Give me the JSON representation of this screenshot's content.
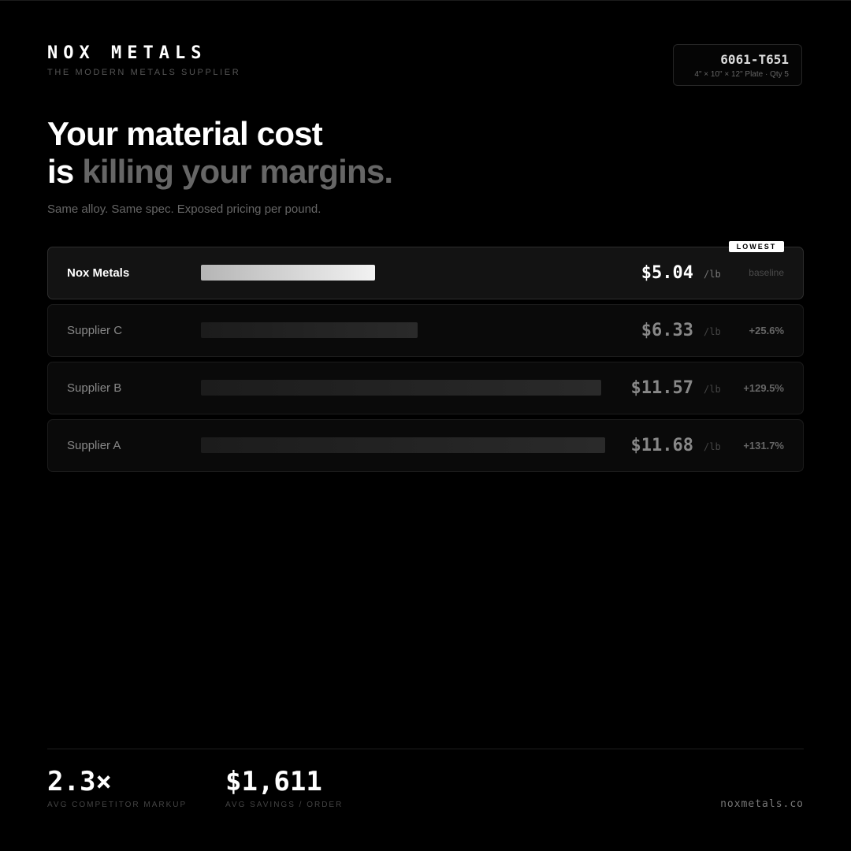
{
  "brand": {
    "name": "NOX METALS",
    "tagline": "THE MODERN METALS SUPPLIER"
  },
  "spec": {
    "alloy": "6061-T651",
    "detail": "4\" × 10\" × 12\" Plate · Qty 5"
  },
  "headline": {
    "line1": "Your material cost",
    "line2_lead": "is",
    "line2_rest": "killing your margins."
  },
  "subhead": "Same alloy. Same spec. Exposed pricing per pound.",
  "badge": "LOWEST",
  "suppliers": [
    {
      "name": "Nox Metals",
      "price": "$5.04",
      "unit": "/lb",
      "delta": "baseline",
      "bar_fraction": 0.41
    },
    {
      "name": "Supplier C",
      "price": "$6.33",
      "unit": "/lb",
      "delta": "+25.6%",
      "bar_fraction": 0.51
    },
    {
      "name": "Supplier B",
      "price": "$11.57",
      "unit": "/lb",
      "delta": "+129.5%",
      "bar_fraction": 0.94
    },
    {
      "name": "Supplier A",
      "price": "$11.68",
      "unit": "/lb",
      "delta": "+131.7%",
      "bar_fraction": 0.95
    }
  ],
  "stats": [
    {
      "value": "2.3×",
      "label": "AVG COMPETITOR MARKUP"
    },
    {
      "value": "$1,611",
      "label": "AVG SAVINGS / ORDER"
    }
  ],
  "site": "noxmetals.co",
  "colors": {
    "background": "#000000",
    "highlight_bar": "#f2f2f2",
    "muted_text": "#666666"
  }
}
